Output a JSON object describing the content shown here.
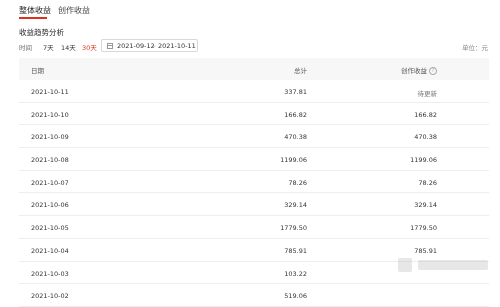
{
  "tabs": [
    {
      "label": "整体收益",
      "active": true
    },
    {
      "label": "创作收益",
      "active": false
    }
  ],
  "section_title": "收益趋势分析",
  "filter": {
    "label": "时间",
    "ranges": [
      "7天",
      "14天",
      "30天"
    ],
    "active_range": "30天",
    "date_start": "2021-09-12",
    "date_separator": "~",
    "date_end": "2021-10-11"
  },
  "unit": "单位：元",
  "table": {
    "headers": {
      "date": "日期",
      "total": "总计",
      "create": "创作收益"
    },
    "rows": [
      {
        "date": "2021-10-11",
        "total": "337.81",
        "create": "待更新"
      },
      {
        "date": "2021-10-10",
        "total": "166.82",
        "create": "166.82"
      },
      {
        "date": "2021-10-09",
        "total": "470.38",
        "create": "470.38"
      },
      {
        "date": "2021-10-08",
        "total": "1199.06",
        "create": "1199.06"
      },
      {
        "date": "2021-10-07",
        "total": "78.26",
        "create": "78.26"
      },
      {
        "date": "2021-10-06",
        "total": "329.14",
        "create": "329.14"
      },
      {
        "date": "2021-10-05",
        "total": "1779.50",
        "create": "1779.50"
      },
      {
        "date": "2021-10-04",
        "total": "785.91",
        "create": "785.91"
      },
      {
        "date": "2021-10-03",
        "total": "103.22",
        "create": ""
      },
      {
        "date": "2021-10-02",
        "total": "519.06",
        "create": ""
      }
    ]
  },
  "colors": {
    "accent": "#e0301e",
    "header_bg": "#f7f7f7",
    "border": "#eeeeee"
  }
}
